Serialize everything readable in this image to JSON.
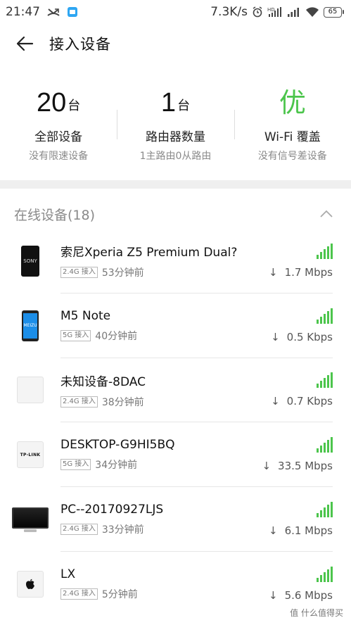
{
  "status_bar": {
    "time": "21:47",
    "net_speed": "7.3K/s",
    "hd_label": "HD",
    "battery": "65",
    "icons": [
      "missed-call-icon",
      "notification-app-icon",
      "alarm-icon",
      "hd-signal-icon",
      "cell-signal-icon",
      "wifi-icon",
      "battery-icon"
    ]
  },
  "app_bar": {
    "title": "接入设备",
    "back_icon": "back-arrow-icon"
  },
  "summary": {
    "all_devices": {
      "value": "20",
      "unit": "台",
      "label": "全部设备",
      "sub": "没有限速设备"
    },
    "routers": {
      "value": "1",
      "unit": "台",
      "label": "路由器数量",
      "sub": "1主路由0从路由"
    },
    "wifi_coverage": {
      "value": "优",
      "label": "Wi-Fi 覆盖",
      "sub": "没有信号差设备",
      "color": "#4cc54c"
    }
  },
  "section": {
    "title": "在线设备(18)",
    "collapse_icon": "chevron-up-icon"
  },
  "devices": [
    {
      "name": "索尼Xperia Z5 Premium Dual?",
      "band": "2.4G 接入",
      "time": "53分钟前",
      "speed": "1.7 Mbps",
      "icon": "sony-phone-icon",
      "brand_text": "SONY"
    },
    {
      "name": "M5 Note",
      "band": "5G 接入",
      "time": "40分钟前",
      "speed": "0.5 Kbps",
      "icon": "meizu-phone-icon",
      "brand_text": "MEIZU"
    },
    {
      "name": "未知设备-8DAC",
      "band": "2.4G 接入",
      "time": "38分钟前",
      "speed": "0.7 Kbps",
      "icon": "unknown-device-icon"
    },
    {
      "name": "DESKTOP-G9HI5BQ",
      "band": "5G 接入",
      "time": "34分钟前",
      "speed": "33.5 Mbps",
      "icon": "tplink-icon",
      "brand_text": "TP-LINK"
    },
    {
      "name": "PC--20170927LJS",
      "band": "2.4G 接入",
      "time": "33分钟前",
      "speed": "6.1 Mbps",
      "icon": "monitor-icon"
    },
    {
      "name": "LX",
      "band": "2.4G 接入",
      "time": "5分钟前",
      "speed": "5.6 Mbps",
      "icon": "apple-icon"
    }
  ],
  "signal_color": "#4cc54c",
  "speed_arrow": "↓",
  "watermark": "值 什么值得买"
}
